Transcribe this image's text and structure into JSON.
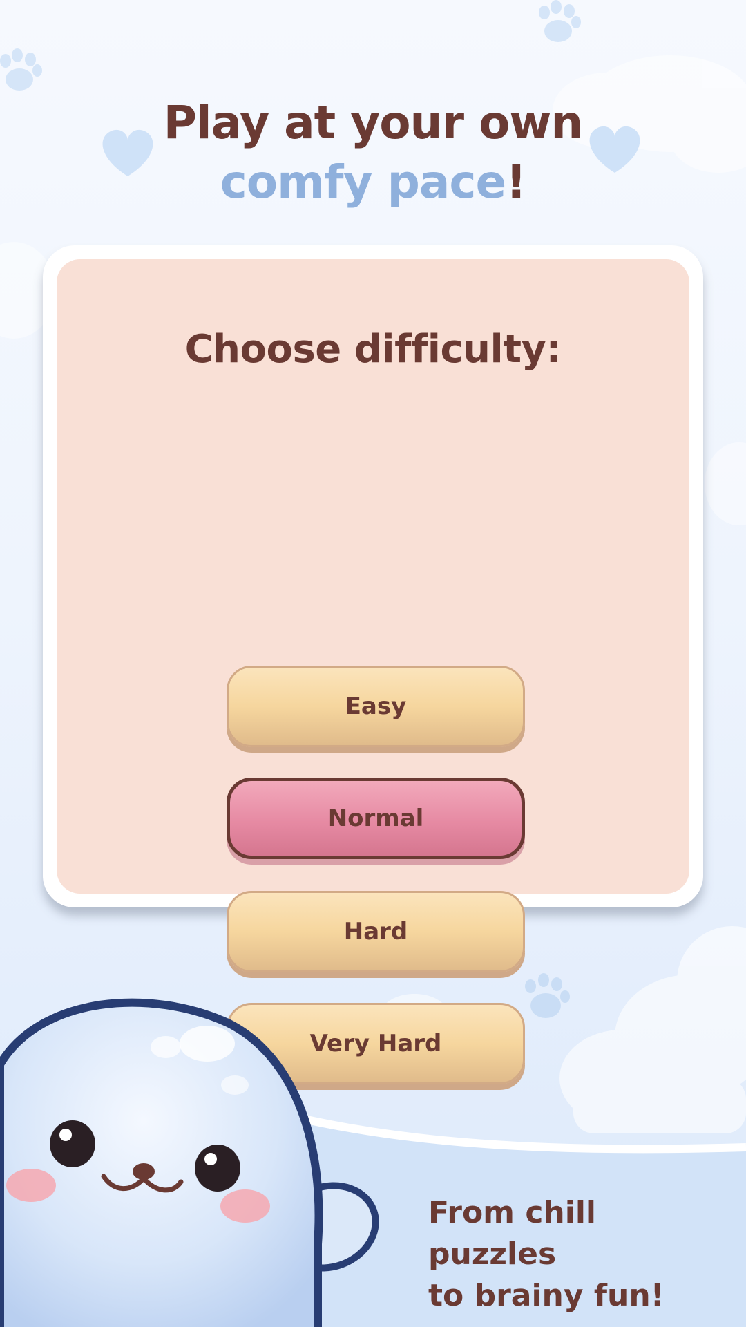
{
  "heading": {
    "line1": "Play at your own",
    "accent": "comfy pace",
    "suffix": "!"
  },
  "card": {
    "title": "Choose difficulty:",
    "selected": "Normal",
    "options": [
      "Easy",
      "Normal",
      "Hard",
      "Very Hard"
    ]
  },
  "tagline": {
    "line1": "From chill puzzles",
    "line2": "to brainy fun!"
  },
  "colors": {
    "text_brown": "#6a3a33",
    "accent_blue": "#8fb0dc",
    "card_bg": "#f9e0d6",
    "button_yellow": "#f6d69e",
    "button_pink_selected": "#e68aa3"
  },
  "icons": [
    "paw-icon",
    "heart-icon",
    "cloud-icon",
    "seal-mascot"
  ]
}
